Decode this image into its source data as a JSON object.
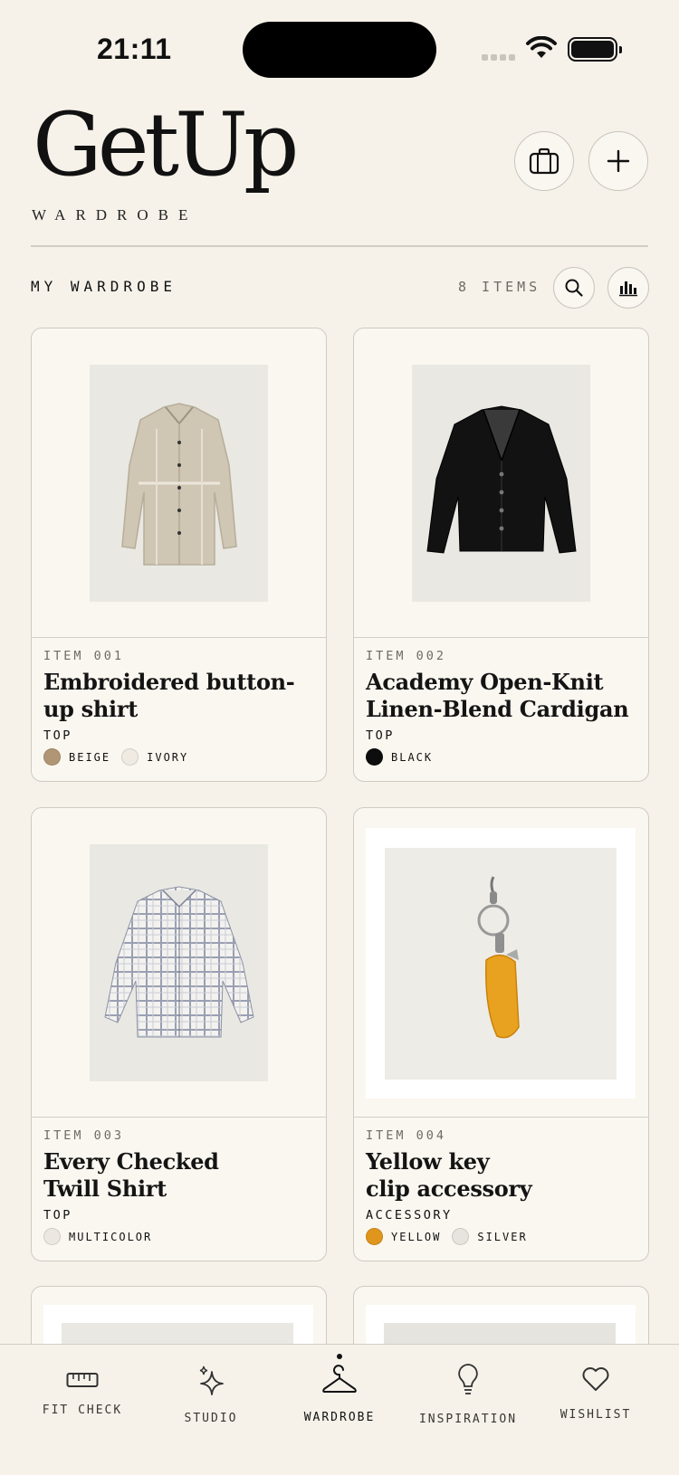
{
  "status_bar": {
    "time": "21:11"
  },
  "header": {
    "brand": "GetUp",
    "subtitle": "WARDROBE",
    "suitcase_icon": "suitcase-icon",
    "add_icon": "plus-icon"
  },
  "section": {
    "title": "MY WARDROBE",
    "count": "8 ITEMS",
    "search_icon": "search-icon",
    "stats_icon": "bar-chart-icon"
  },
  "items": [
    {
      "number": "ITEM 001",
      "name_line1": "Embroidered button-",
      "name_line2": "up shirt",
      "category": "TOP",
      "colors": [
        {
          "label": "BEIGE",
          "hex": "#b09674"
        },
        {
          "label": "IVORY",
          "hex": "#efebe2"
        }
      ]
    },
    {
      "number": "ITEM 002",
      "name_line1": "Academy Open-Knit",
      "name_line2": "Linen-Blend Cardigan",
      "category": "TOP",
      "colors": [
        {
          "label": "BLACK",
          "hex": "#0d0d0d"
        }
      ]
    },
    {
      "number": "ITEM 003",
      "name_line1": "Every Checked",
      "name_line2": "Twill Shirt",
      "category": "TOP",
      "colors": [
        {
          "label": "MULTICOLOR",
          "hex": "#ece8e1"
        }
      ]
    },
    {
      "number": "ITEM 004",
      "name_line1": "Yellow key",
      "name_line2": "clip accessory",
      "category": "ACCESSORY",
      "colors": [
        {
          "label": "YELLOW",
          "hex": "#e0951c"
        },
        {
          "label": "SILVER",
          "hex": "#e6e4df"
        }
      ]
    }
  ],
  "tabbar": {
    "tabs": [
      {
        "label": "FIT CHECK",
        "icon": "ruler-icon"
      },
      {
        "label": "STUDIO",
        "icon": "sparkle-icon"
      },
      {
        "label": "WARDROBE",
        "icon": "hanger-icon",
        "active": true
      },
      {
        "label": "INSPIRATION",
        "icon": "lightbulb-icon"
      },
      {
        "label": "WISHLIST",
        "icon": "heart-icon"
      }
    ]
  }
}
